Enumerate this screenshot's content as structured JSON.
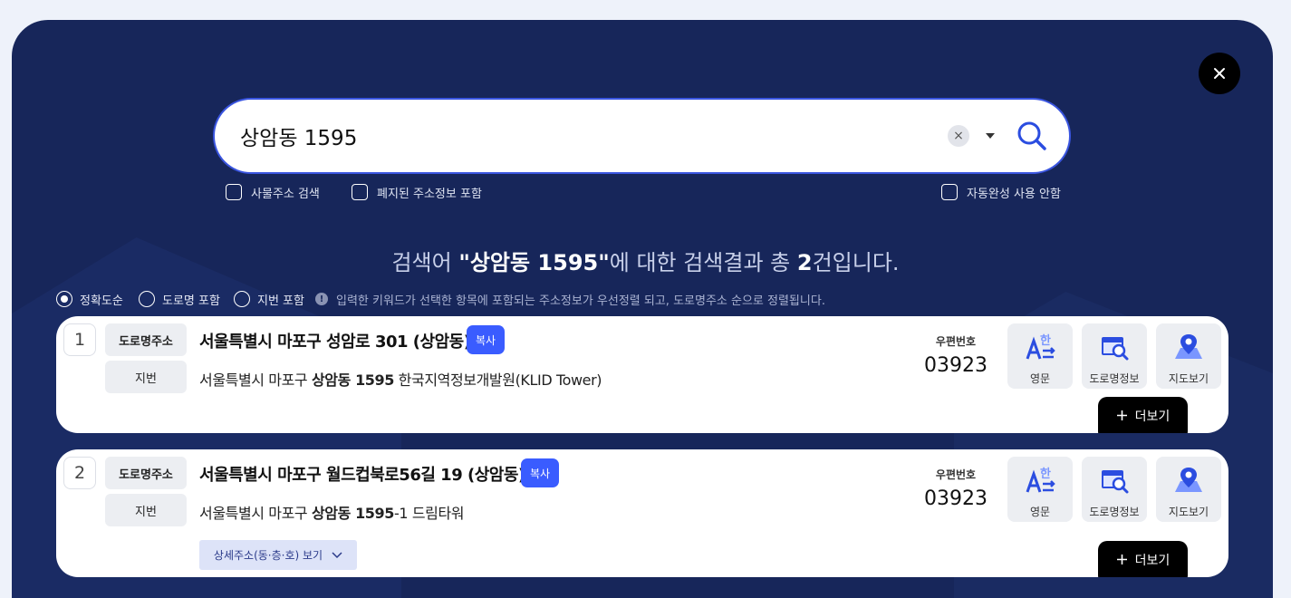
{
  "search": {
    "value": "상암동 1595",
    "clear_label": "×"
  },
  "options": {
    "building_search": "사물주소 검색",
    "include_abolished": "폐지된 주소정보 포함",
    "disable_autocomplete": "자동완성 사용 안함"
  },
  "summary": {
    "prefix": "검색어 ",
    "keyword": "\"상암동 1595\"",
    "middle": "에 대한 검색결과 총 ",
    "count": "2",
    "suffix": "건입니다."
  },
  "sort": {
    "accuracy": "정확도순",
    "road_name": "도로명 포함",
    "jibun": "지번 포함",
    "selected": "accuracy",
    "note": "입력한 키워드가 선택한 항목에 포함되는 주소정보가 우선정렬 되고, 도로명주소 순으로 정렬됩니다."
  },
  "labels": {
    "road_tag": "도로명주소",
    "jibun_tag": "지번",
    "copy": "복사",
    "zip_label": "우편번호",
    "english": "영문",
    "road_info": "도로명정보",
    "map": "지도보기",
    "more": "더보기",
    "detail": "상세주소(동·층·호) 보기",
    "info_icon_glyph": "!"
  },
  "results": [
    {
      "no": "1",
      "road_address": "서울특별시 마포구 성암로 301 (상암동)",
      "jibun_prefix": "서울특별시 마포구 ",
      "jibun_bold": "상암동 1595",
      "jibun_suffix": " 한국지역정보개발원(KLID Tower)",
      "zip": "03923"
    },
    {
      "no": "2",
      "road_address": "서울특별시 마포구 월드컵북로56길 19 (상암동)",
      "jibun_prefix": "서울특별시 마포구 ",
      "jibun_bold": "상암동 1595",
      "jibun_suffix": "-1 드림타워",
      "zip": "03923"
    }
  ],
  "colors": {
    "panel_bg": "#17265a",
    "accent": "#3a5cff",
    "search_border": "#3a55e0"
  },
  "icons": [
    "close-icon",
    "clear-icon",
    "caret-down-icon",
    "search-icon",
    "english-translate-icon",
    "road-info-icon",
    "map-pin-icon",
    "plus-icon",
    "chevron-down-icon",
    "info-icon"
  ]
}
